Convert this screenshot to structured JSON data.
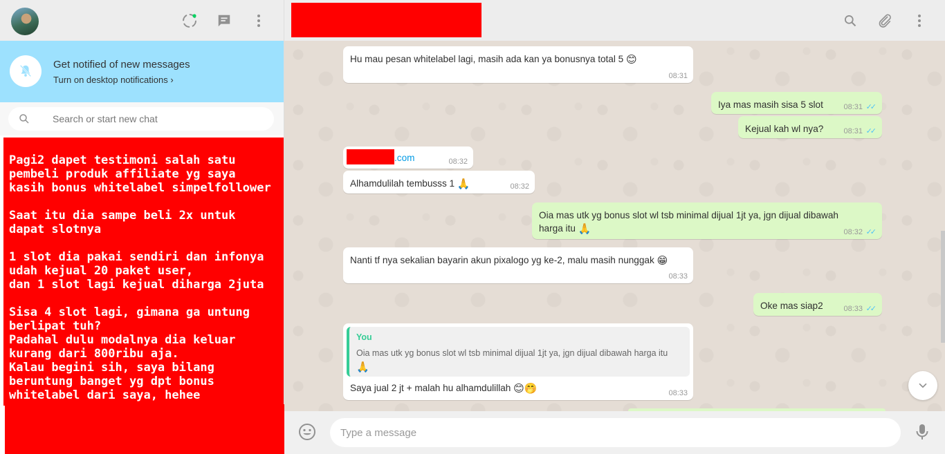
{
  "sidebar": {
    "notification": {
      "title": "Get notified of new messages",
      "link": "Turn on desktop notifications ›"
    },
    "search": {
      "placeholder": "Search or start new chat"
    }
  },
  "overlay": {
    "text": "Pagi2 dapet testimoni salah satu\npembeli produk affiliate yg saya\nkasih bonus whitelabel simpelfollower\n\nSaat itu dia sampe beli 2x untuk\ndapat slotnya\n\n1 slot dia pakai sendiri dan infonya\nudah kejual 20 paket user,\ndan 1 slot lagi kejual diharga 2juta\n\nSisa 4 slot lagi, gimana ga untung\nberlipat tuh?\nPadahal dulu modalnya dia keluar\nkurang dari 800ribu aja.\nKalau begini sih, saya bilang\nberuntung banget yg dpt bonus\nwhitelabel dari saya, hehee"
  },
  "messages": [
    {
      "dir": "in",
      "text": "Hu mau pesan whitelabel lagi, masih ada kan ya bonusnya total 5 ",
      "emoji": "😊",
      "time": "08:31"
    },
    {
      "dir": "out",
      "text": "Iya mas masih sisa 5 slot",
      "time": "08:31",
      "ticks": "✓✓"
    },
    {
      "dir": "out",
      "text": "Kejual kah wl nya?",
      "time": "08:31",
      "ticks": "✓✓"
    },
    {
      "dir": "in",
      "link": ".com",
      "time": "08:32"
    },
    {
      "dir": "in",
      "text": "Alhamdulilah tembusss 1 ",
      "emoji": "🙏",
      "time": "08:32"
    },
    {
      "dir": "out",
      "text": "Oia mas utk yg bonus slot wl tsb minimal dijual 1jt ya, jgn dijual dibawah harga itu ",
      "emoji": "🙏",
      "time": "08:32",
      "ticks": "✓✓"
    },
    {
      "dir": "in",
      "text": "Nanti tf nya sekalian bayarin akun pixalogo yg ke-2, malu masih nunggak ",
      "emoji": "😁",
      "time": "08:33"
    },
    {
      "dir": "out",
      "text": "Oke mas siap2",
      "time": "08:33",
      "ticks": "✓✓"
    },
    {
      "dir": "in",
      "quote_author": "You",
      "quote_text": "Oia mas utk yg bonus slot wl tsb minimal dijual 1jt ya, jgn dijual dibawah harga itu ",
      "quote_emoji": "🙏",
      "text": "Saya jual 2 jt + malah hu alhamdulillah ",
      "emoji": "😊🤭",
      "time": "08:33"
    }
  ],
  "composer": {
    "placeholder": "Type a message"
  },
  "colors": {
    "incoming": "#ffffff",
    "outgoing": "#dcf8c6",
    "banner": "#9de1fe",
    "redaction": "#ff0000",
    "tick": "#4fc3f7"
  }
}
